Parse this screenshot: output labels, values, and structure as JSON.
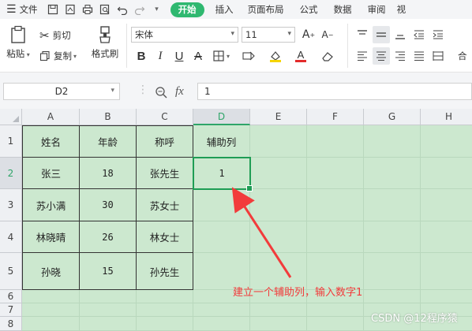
{
  "menubar": {
    "file_label": "文件",
    "tabs": [
      "开始",
      "插入",
      "页面布局",
      "公式",
      "数据",
      "审阅",
      "视"
    ],
    "active_tab": "开始",
    "accent": "#2fb870"
  },
  "ribbon": {
    "paste_label": "粘贴",
    "cut_label": "剪切",
    "copy_label": "复制",
    "format_painter_label": "格式刷",
    "font_name": "宋体",
    "font_size": "11",
    "merge_label": "合"
  },
  "formula_bar": {
    "cell_ref": "D2",
    "fx_label": "fx",
    "value": "1"
  },
  "sheet": {
    "columns": [
      "A",
      "B",
      "C",
      "D",
      "E",
      "F",
      "G",
      "H"
    ],
    "rows": [
      "1",
      "2",
      "3",
      "4",
      "5",
      "6",
      "7",
      "8"
    ],
    "selected_column": "D",
    "selected_row": "2",
    "header_row": [
      "姓名",
      "年龄",
      "称呼",
      "辅助列"
    ],
    "data": [
      [
        "张三",
        "18",
        "张先生",
        "1"
      ],
      [
        "苏小满",
        "30",
        "苏女士",
        ""
      ],
      [
        "林晓晴",
        "26",
        "林女士",
        ""
      ],
      [
        "孙晓",
        "15",
        "孙先生",
        ""
      ]
    ],
    "grid_color": "#cce8cf"
  },
  "annotation": {
    "text": "建立一个辅助列，输入数字1",
    "color": "#f23b3b"
  },
  "watermark": "CSDN @12程序猿"
}
